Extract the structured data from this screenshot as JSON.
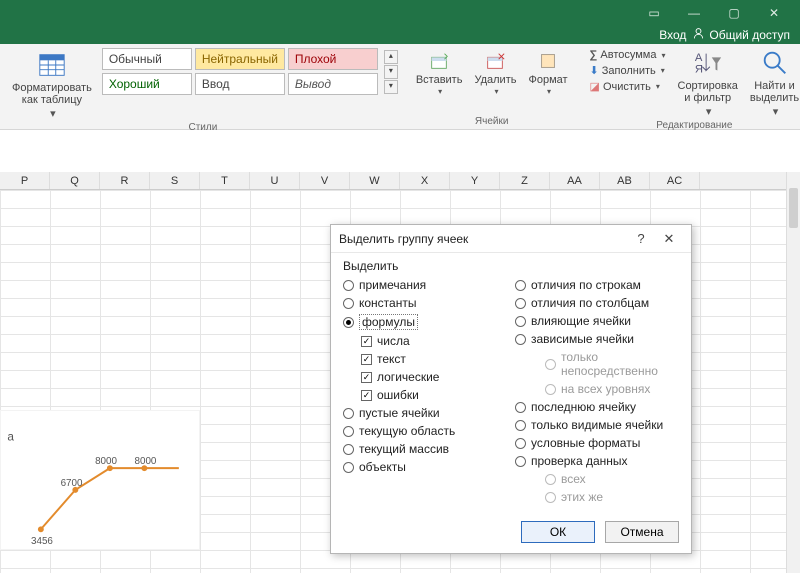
{
  "titlebar": {
    "login": "Вход",
    "share": "Общий доступ"
  },
  "ribbon": {
    "format_table": "Форматировать\nкак таблицу",
    "styles_label": "Стили",
    "styles": {
      "normal": "Обычный",
      "neutral": "Нейтральный",
      "bad": "Плохой",
      "good": "Хороший",
      "input": "Ввод",
      "output": "Вывод"
    },
    "cells_label": "Ячейки",
    "cells": {
      "insert": "Вставить",
      "delete": "Удалить",
      "format": "Формат"
    },
    "editing_label": "Редактирование",
    "editing": {
      "autosum": "Автосумма",
      "fill": "Заполнить",
      "clear": "Очистить",
      "sort": "Сортировка\nи фильтр",
      "find": "Найти и\nвыделить"
    }
  },
  "columns": [
    "P",
    "Q",
    "R",
    "S",
    "T",
    "U",
    "V",
    "W",
    "X",
    "Y",
    "Z",
    "AA",
    "AB",
    "AC"
  ],
  "chart_data": {
    "type": "line",
    "x": [
      1,
      2,
      3,
      4,
      5
    ],
    "values": [
      3456,
      6700,
      8000,
      8000,
      8000
    ],
    "labels": [
      "3456",
      "6700",
      "8000",
      "8000",
      ""
    ],
    "ylim": [
      0,
      9000
    ],
    "legend_hint": "а"
  },
  "dialog": {
    "title": "Выделить группу ячеек",
    "section": "Выделить",
    "left": {
      "notes": "примечания",
      "constants": "константы",
      "formulas": "формулы",
      "numbers": "числа",
      "text": "текст",
      "logical": "логические",
      "errors": "ошибки",
      "blanks": "пустые ячейки",
      "current_region": "текущую область",
      "current_array": "текущий массив",
      "objects": "объекты"
    },
    "right": {
      "row_diff": "отличия по строкам",
      "col_diff": "отличия по столбцам",
      "precedents": "влияющие ячейки",
      "dependents": "зависимые ячейки",
      "direct_only": "только непосредственно",
      "all_levels": "на всех уровнях",
      "last_cell": "последнюю ячейку",
      "visible_only": "только видимые ячейки",
      "cond_formats": "условные форматы",
      "data_validation": "проверка данных",
      "all": "всех",
      "same": "этих же"
    },
    "ok": "ОК",
    "cancel": "Отмена"
  }
}
